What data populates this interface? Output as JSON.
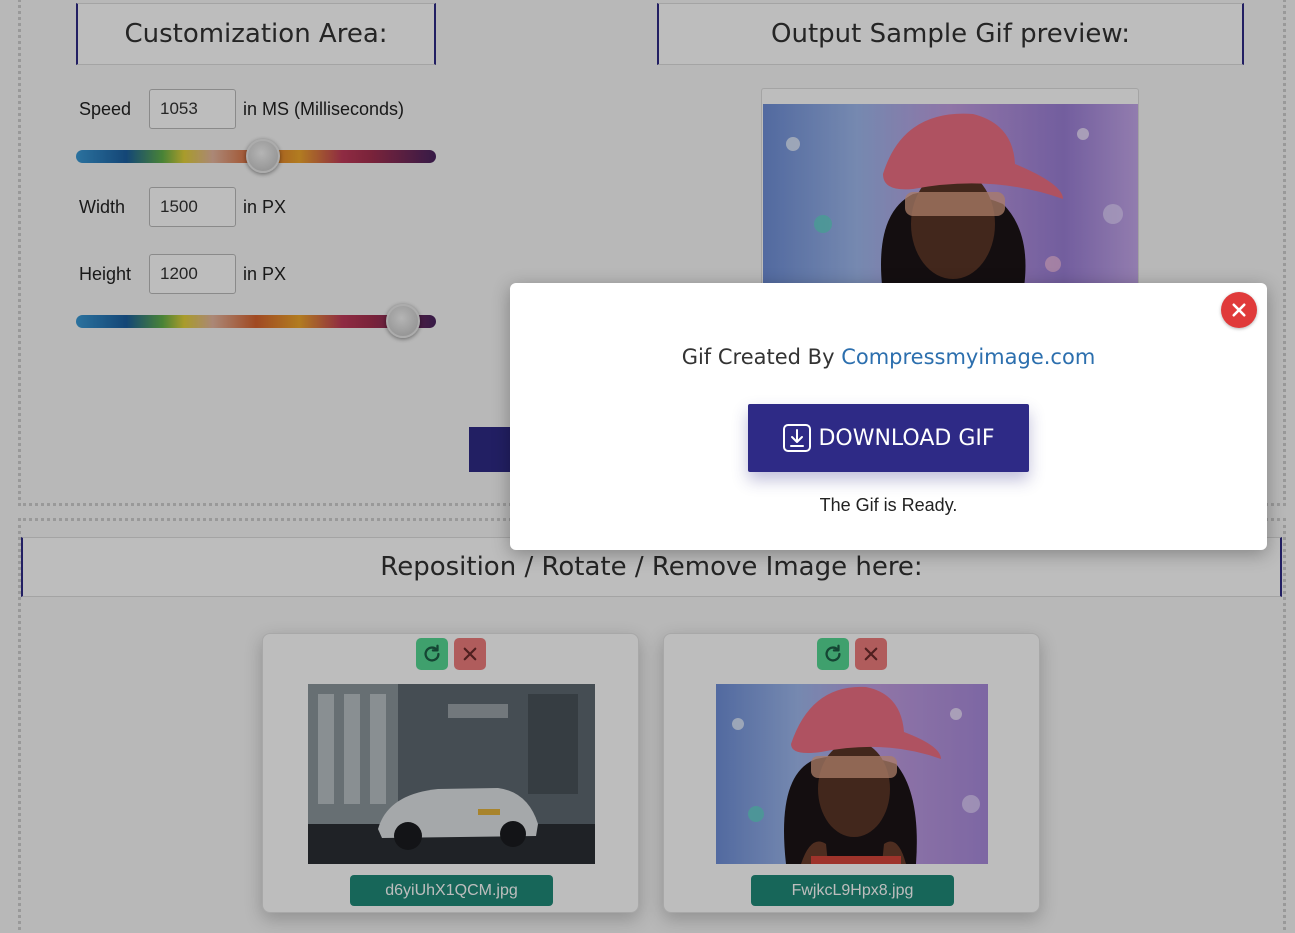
{
  "customization": {
    "title": "Customization Area:",
    "speed": {
      "label": "Speed",
      "value": "1053",
      "unit": "in MS (Milliseconds)",
      "slider_fraction": 0.52
    },
    "width": {
      "label": "Width",
      "value": "1500",
      "unit": "in PX"
    },
    "height": {
      "label": "Height",
      "value": "1200",
      "unit": "in PX",
      "slider_fraction": 0.95
    }
  },
  "preview": {
    "title": "Output Sample Gif preview:"
  },
  "reposition": {
    "title": "Reposition / Rotate / Remove Image here:",
    "images": [
      {
        "filename": "d6yiUhX1QCM.jpg"
      },
      {
        "filename": "FwjkcL9Hpx8.jpg"
      }
    ]
  },
  "modal": {
    "heading_prefix": "Gif Created By",
    "heading_brand": "Compressmyimage.com",
    "download_label": "DOWNLOAD GIF",
    "status": "The Gif is Ready."
  },
  "colors": {
    "primary": "#2e2a86",
    "accent_teal": "#1f8a78",
    "close_red": "#e03a3a",
    "link_blue": "#2c6fae"
  },
  "icons": [
    "rotate-icon",
    "close-icon",
    "download-icon"
  ]
}
